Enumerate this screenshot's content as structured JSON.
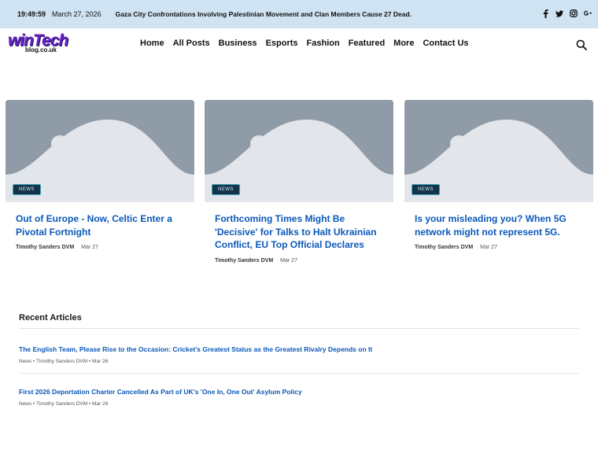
{
  "topbar": {
    "time": "19:49:59",
    "date": "March 27, 2026",
    "headline": "Gaza City Confrontations Involving Palestinian Movement and Clan Members Cause 27 Dead."
  },
  "social_icons": [
    "facebook-icon",
    "twitter-icon",
    "instagram-icon",
    "google-plus-icon"
  ],
  "logo": {
    "main": "winTech",
    "sub": "blog.co.uk"
  },
  "nav": {
    "items": [
      "Home",
      "All Posts",
      "Business",
      "Esports",
      "Fashion",
      "Featured",
      "More",
      "Contact Us"
    ]
  },
  "cards": [
    {
      "badge": "NEWS",
      "title": "Out of Europe - Now, Celtic Enter a Pivotal Fortnight",
      "author": "Timothy Sanders DVM",
      "date": "Mar 27"
    },
    {
      "badge": "NEWS",
      "title": "Forthcoming Times Might Be 'Decisive' for Talks to Halt Ukrainian Conflict, EU Top Official Declares",
      "author": "Timothy Sanders DVM",
      "date": "Mar 27"
    },
    {
      "badge": "NEWS",
      "title": "Is your misleading you? When 5G network might not represent 5G.",
      "author": "Timothy Sanders DVM",
      "date": "Mar 27"
    }
  ],
  "recent": {
    "heading": "Recent Articles",
    "articles": [
      {
        "title": "The English Team, Please Rise to the Occasion: Cricket's Greatest Status as the Greatest Rivalry Depends on It",
        "meta": "News • Timothy Sanders DVM • Mar 26"
      },
      {
        "title": "First 2026 Deportation Charter Cancelled As Part of UK's 'One In, One Out' Asylum Policy",
        "meta": "News • Timothy Sanders DVM • Mar 26"
      }
    ]
  },
  "colors": {
    "topbar_bg": "#cfe3f2",
    "link_blue": "#0a58b9",
    "logo_purple": "#6a1ec4",
    "badge_bg": "#13344a"
  }
}
